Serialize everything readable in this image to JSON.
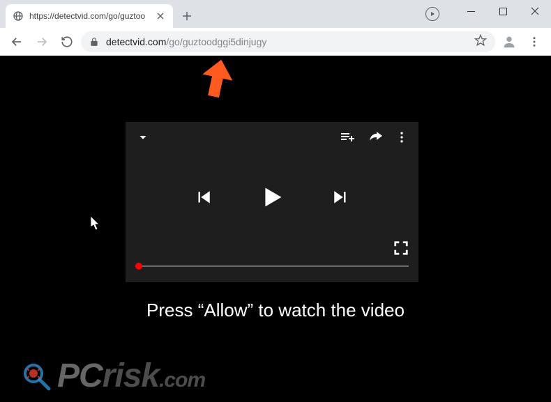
{
  "window": {
    "minimize": "–",
    "maximize": "□",
    "close": "×"
  },
  "tab": {
    "title": "https://detectvid.com/go/guztoo"
  },
  "url": {
    "domain": "detectvid.com",
    "path": "/go/guztoodggi5dinjugy"
  },
  "player": {
    "minimize_icon": "chevron-down",
    "queue_icon": "playlist-add",
    "share_icon": "share",
    "more_icon": "more-vert",
    "prev_icon": "skip-previous",
    "play_icon": "play",
    "next_icon": "skip-next",
    "fullscreen_icon": "fullscreen",
    "progress_color": "#ff0000"
  },
  "page": {
    "caption": "Press “Allow” to watch the video"
  },
  "watermark": {
    "pc": "PC",
    "risk": "risk",
    "com": ".com"
  }
}
